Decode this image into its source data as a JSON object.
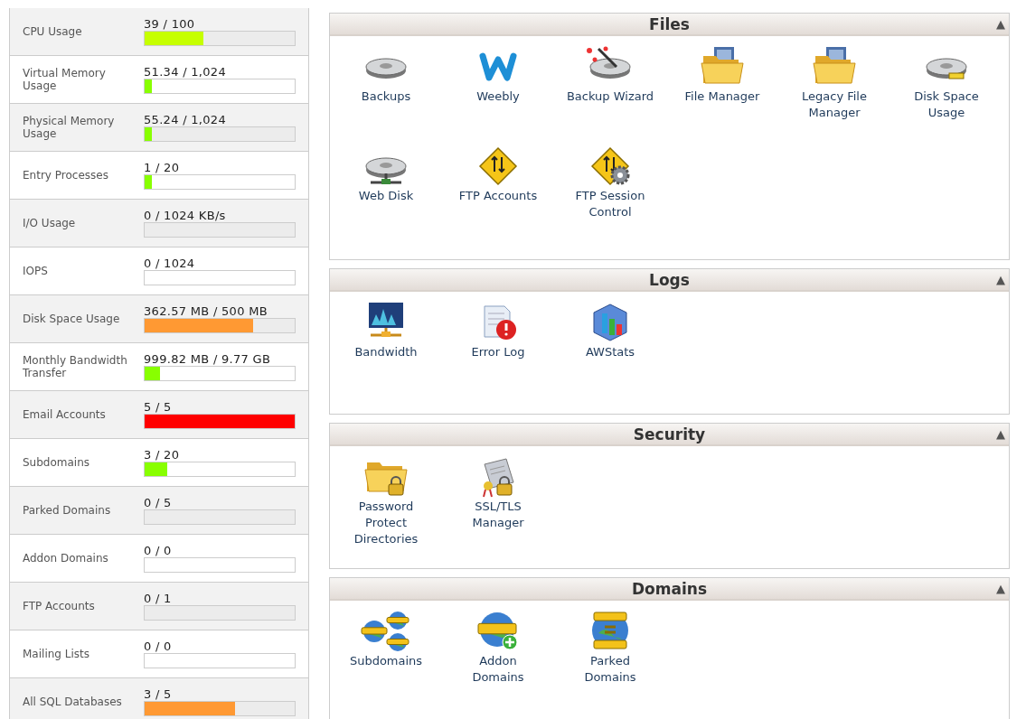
{
  "stats": [
    {
      "label": "CPU Usage",
      "reading": "39 / 100",
      "level": 0.39,
      "color": "#c6ff00"
    },
    {
      "label": "Virtual Memory Usage",
      "reading": "51.34 / 1,024",
      "level": 0.05,
      "color": "#88ff00"
    },
    {
      "label": "Physical Memory Usage",
      "reading": "55.24 / 1,024",
      "level": 0.05,
      "color": "#88ff00"
    },
    {
      "label": "Entry Processes",
      "reading": "1 / 20",
      "level": 0.05,
      "color": "#88ff00"
    },
    {
      "label": "I/O Usage",
      "reading": "0 / 1024 KB/s",
      "level": 0
    },
    {
      "label": "IOPS",
      "reading": "0 / 1024",
      "level": 0
    },
    {
      "label": "Disk Space Usage",
      "reading": "362.57 MB / 500 MB",
      "level": 0.72,
      "color": "#ff9933"
    },
    {
      "label": "Monthly Bandwidth Transfer",
      "reading": "999.82 MB / 9.77 GB",
      "level": 0.1,
      "color": "#88ff00"
    },
    {
      "label": "Email Accounts",
      "reading": "5 / 5",
      "level": 1,
      "color": "#ff0000"
    },
    {
      "label": "Subdomains",
      "reading": "3 / 20",
      "level": 0.15,
      "color": "#88ff00"
    },
    {
      "label": "Parked Domains",
      "reading": "0 / 5",
      "level": 0
    },
    {
      "label": "Addon Domains",
      "reading": "0 / 0",
      "level": 0
    },
    {
      "label": "FTP Accounts",
      "reading": "0 / 1",
      "level": 0
    },
    {
      "label": "Mailing Lists",
      "reading": "0 / 0",
      "level": 0
    },
    {
      "label": "All SQL Databases",
      "reading": "3 / 5",
      "level": 0.6,
      "color": "#ff9933"
    }
  ],
  "sections": [
    {
      "title": "Files",
      "toggle": "▲",
      "items": [
        "Backups",
        "Weebly",
        "Backup Wizard",
        "File Manager",
        "Legacy File Manager",
        "Disk Space Usage",
        "Web Disk",
        "FTP Accounts",
        "FTP Session Control"
      ]
    },
    {
      "title": "Logs",
      "toggle": "▲",
      "items": [
        "Bandwidth",
        "Error Log",
        "AWStats"
      ]
    },
    {
      "title": "Security",
      "toggle": "▲",
      "items": [
        "Password Protect Directories",
        "SSL/TLS Manager"
      ]
    },
    {
      "title": "Domains",
      "toggle": "▲",
      "items": [
        "Subdomains",
        "Addon Domains",
        "Parked Domains"
      ]
    }
  ]
}
